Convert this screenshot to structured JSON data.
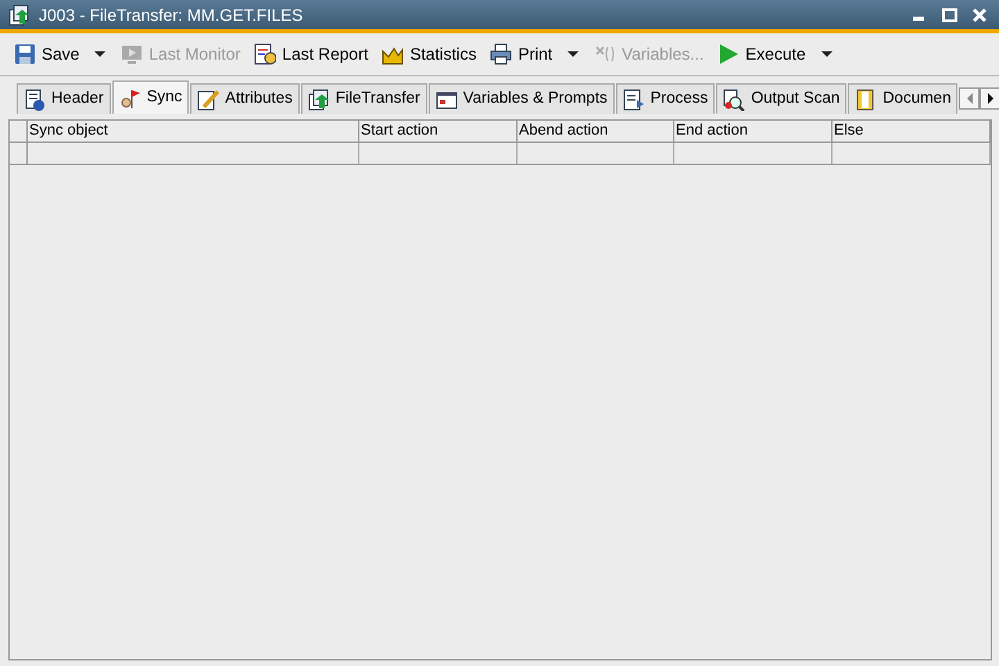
{
  "window": {
    "title": "J003 - FileTransfer: MM.GET.FILES"
  },
  "toolbar": [
    {
      "label": "Save",
      "disabled": false,
      "dropdown": true
    },
    {
      "label": "Last Monitor",
      "disabled": true,
      "dropdown": false
    },
    {
      "label": "Last Report",
      "disabled": false,
      "dropdown": false
    },
    {
      "label": "Statistics",
      "disabled": false,
      "dropdown": false
    },
    {
      "label": "Print",
      "disabled": false,
      "dropdown": true
    },
    {
      "label": "Variables...",
      "disabled": true,
      "dropdown": false
    },
    {
      "label": "Execute",
      "disabled": false,
      "dropdown": true
    }
  ],
  "tabs": [
    {
      "label": "Header",
      "selected": false
    },
    {
      "label": "Sync",
      "selected": true
    },
    {
      "label": "Attributes",
      "selected": false
    },
    {
      "label": "FileTransfer",
      "selected": false
    },
    {
      "label": "Variables & Prompts",
      "selected": false
    },
    {
      "label": "Process",
      "selected": false
    },
    {
      "label": "Output Scan",
      "selected": false
    },
    {
      "label": "Documen",
      "selected": false
    }
  ],
  "table": {
    "columns": [
      "Sync object",
      "Start action",
      "Abend action",
      "End action",
      "Else"
    ]
  }
}
